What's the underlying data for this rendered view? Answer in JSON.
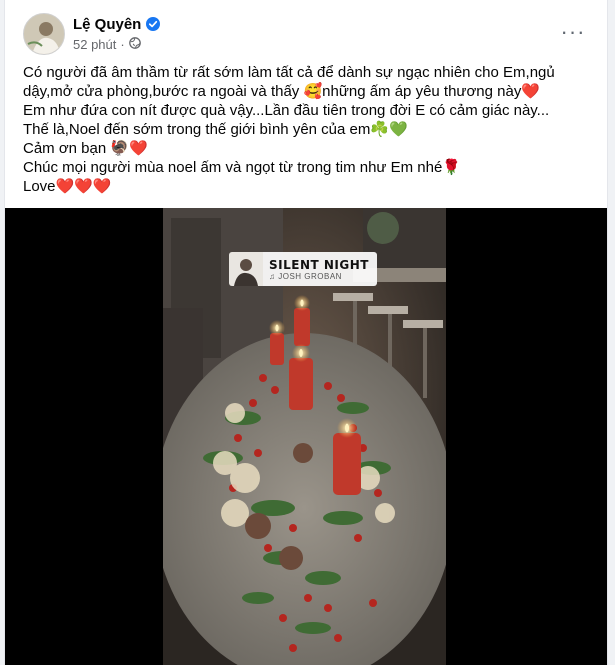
{
  "post": {
    "author_name": "Lệ Quyên",
    "time": "52 phút",
    "meta_separator": "·",
    "verified_icon": "verified-badge-icon",
    "privacy_icon": "globe-icon",
    "more_icon": "more-options-icon",
    "more_label": "···",
    "body_lines": [
      "Có người đã âm thầm từ rất sớm làm tất cả để dành sự ngạc nhiên cho Em,ngủ",
      "dậy,mở cửa phòng,bước ra ngoài và thấy 🥰những ấm áp yêu thương này❤️",
      "Em như đứa con nít được quà vậy...Lần đầu tiên trong đời E có cảm giác này...",
      "Thế là,Noel đến sớm trong thế giới bình yên của em☘️💚",
      "Cảm ơn bạn 🦃❤️",
      "Chúc mọi người mùa noel ấm và ngọt từ trong tim như Em nhé🌹",
      "Love❤️❤️❤️"
    ]
  },
  "video": {
    "music_title": "SILENT NIGHT",
    "music_artist": "♫ JOSH GROBAN",
    "music_icon": "music-note-icon"
  },
  "colors": {
    "verified": "#1877f2",
    "meta_text": "#65676b",
    "media_background": "#000000",
    "candle": "#c0392b"
  }
}
